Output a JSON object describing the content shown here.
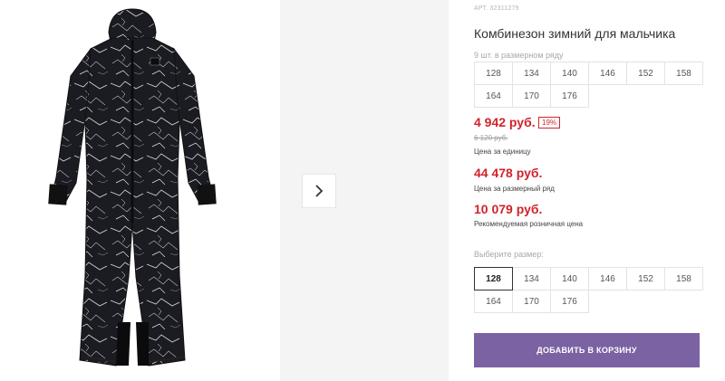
{
  "product": {
    "article": "АРТ. 32311279",
    "title": "Комбинезон зимний для мальчика"
  },
  "pack": {
    "note": "9 шт. в размерном ряду",
    "sizes": [
      "128",
      "134",
      "140",
      "146",
      "152",
      "158",
      "164",
      "170",
      "176"
    ]
  },
  "pricing": {
    "unit_price": "4 942 руб.",
    "discount": "19%",
    "old_price": "6 120 руб.",
    "unit_label": "Цена за единицу",
    "pack_price": "44 478 руб.",
    "pack_label": "Цена за размерный ряд",
    "retail_price": "10 079 руб.",
    "retail_label": "Рекомендуемая розничная цена",
    "accent_color": "#d2232a"
  },
  "size_select": {
    "label": "Выберите размер:",
    "sizes": [
      "128",
      "134",
      "140",
      "146",
      "152",
      "158",
      "164",
      "170",
      "176"
    ],
    "selected": "128"
  },
  "cart": {
    "button_label": "ДОБАВИТЬ В КОРЗИНУ",
    "button_color": "#7b62a3"
  },
  "gallery": {
    "next_icon": "chevron-right-icon"
  }
}
